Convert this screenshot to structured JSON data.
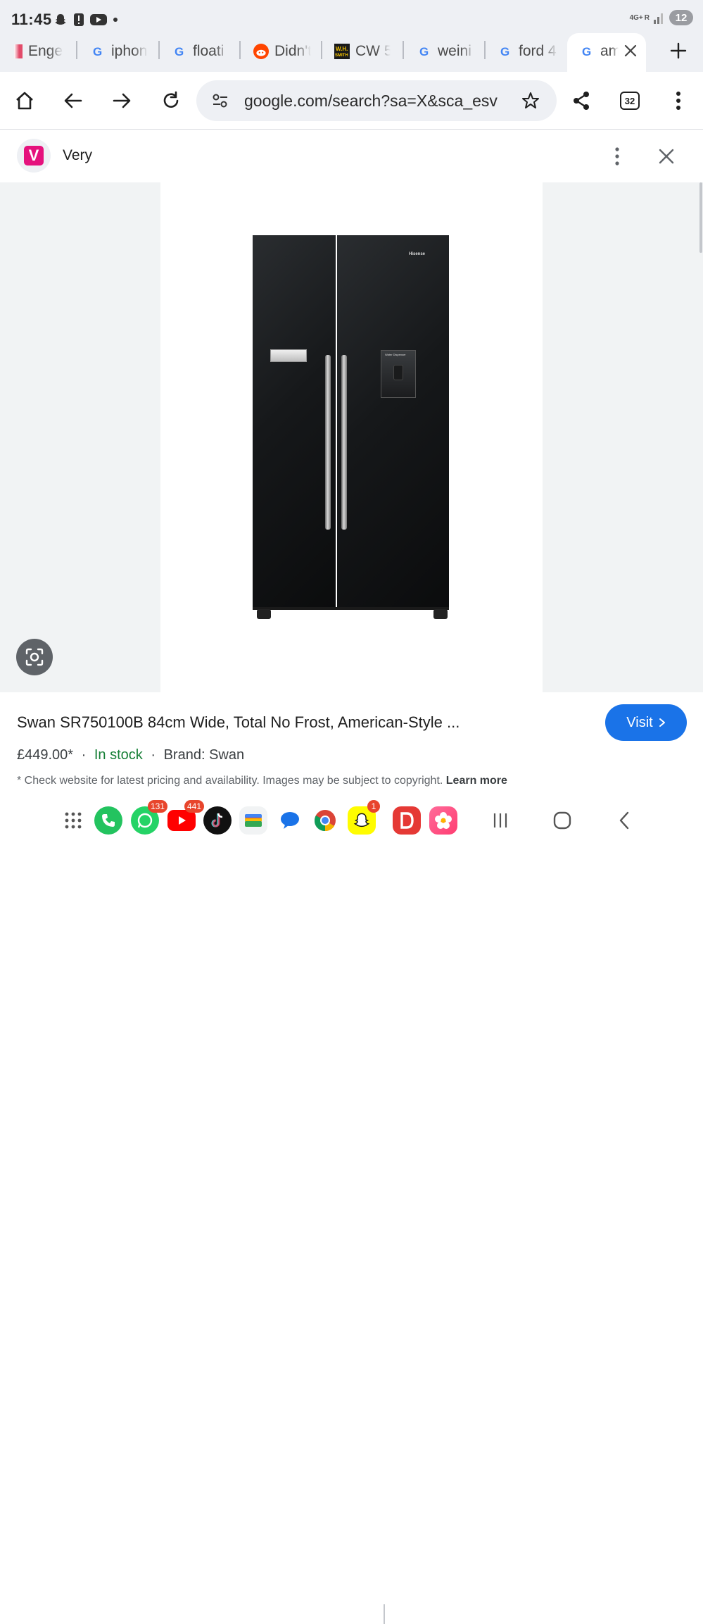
{
  "status_bar": {
    "time": "11:45",
    "network": "4G+",
    "roaming": "R",
    "battery": "12",
    "icons": [
      "snapchat-icon",
      "alert-icon",
      "youtube-icon",
      "dot-icon"
    ]
  },
  "tabs": [
    {
      "title": "Engel",
      "icon": "engel-favicon"
    },
    {
      "title": "iphon",
      "icon": "google-g-icon"
    },
    {
      "title": "floati",
      "icon": "google-g-icon"
    },
    {
      "title": "Didn't",
      "icon": "reddit-icon"
    },
    {
      "title": "CW 5",
      "icon": "whsmith-icon",
      "icon_text": "W.H. SMITH"
    },
    {
      "title": "weini",
      "icon": "google-g-icon"
    },
    {
      "title": "ford 4",
      "icon": "google-g-icon"
    },
    {
      "title": "am",
      "icon": "google-g-icon",
      "active": true
    }
  ],
  "toolbar": {
    "url": "google.com/search?sa=X&sca_esv",
    "tab_count": "32"
  },
  "panel": {
    "site_logo_letter": "V",
    "site_name": "Very"
  },
  "product_image": {
    "brand_text": "Hisense",
    "dispenser_text": "Water Dispenser"
  },
  "product": {
    "title": "Swan SR750100B 84cm Wide, Total No Frost, American-Style ...",
    "price": "£449.00*",
    "stock": "In stock",
    "brand": "Brand: Swan",
    "sep": "·",
    "disclaimer": "* Check website for latest pricing and availability. Images may be subject to copyright.",
    "learn_more": "Learn more",
    "visit_label": "Visit"
  },
  "dock": {
    "whatsapp_badge": "131",
    "youtube_badge": "441",
    "snapchat_badge": "1",
    "apps": [
      "apps-grid-icon",
      "phone-icon",
      "whatsapp-icon",
      "youtube-icon",
      "tiktok-icon",
      "wallet-icon",
      "messages-icon",
      "chrome-icon",
      "snapchat-icon",
      "d-app-icon",
      "flower-app-icon"
    ]
  },
  "colors": {
    "accent": "#1a73e8",
    "stock_green": "#188038",
    "very_pink": "#e5127d"
  }
}
